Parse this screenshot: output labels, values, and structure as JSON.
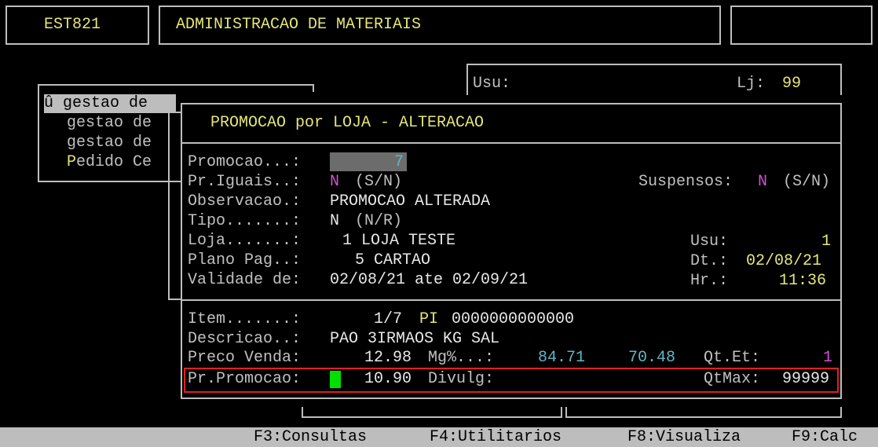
{
  "header": {
    "program_code": "EST821",
    "title": "ADMINISTRACAO DE MATERIAIS"
  },
  "user_box": {
    "usu_label": "Usu:",
    "lj_label": "Lj:",
    "lj_value": "99"
  },
  "menu": {
    "items": [
      {
        "label": "û gestao de"
      },
      {
        "label": "gestao de"
      },
      {
        "label": "gestao de"
      },
      {
        "label_first": "P",
        "label_rest": "edido Ce"
      }
    ]
  },
  "dialog": {
    "title": "PROMOCAO por LOJA - ALTERACAO",
    "promocao_label": "Promocao...:",
    "promocao_value": "7",
    "pr_iguais_label": "Pr.Iguais..:",
    "pr_iguais_value": "N",
    "pr_iguais_hint": "(S/N)",
    "suspensos_label": "Suspensos:",
    "suspensos_value": "N",
    "suspensos_hint": "(S/N)",
    "observacao_label": "Observacao.:",
    "observacao_value": "PROMOCAO ALTERADA",
    "tipo_label": "Tipo.......:",
    "tipo_value": "N",
    "tipo_hint": "(N/R)",
    "loja_label": "Loja.......:",
    "loja_value": "1 LOJA TESTE",
    "usu_label": "Usu:",
    "usu_value": "1",
    "plano_label": "Plano Pag..:",
    "plano_value": "5 CARTAO",
    "dt_label": "Dt.:",
    "dt_value": "02/08/21",
    "validade_label": "Validade de:",
    "validade_value": "02/08/21 ate 02/09/21",
    "hr_label": "Hr.:",
    "hr_value": "11:36",
    "item_label": "Item.......:",
    "item_value": "1/7",
    "pi_label": "PI",
    "pi_value": "0000000000000",
    "descricao_label": "Descricao..:",
    "descricao_value": "PAO 3IRMAOS KG SAL",
    "preco_label": "Preco Venda:",
    "preco_value": "12.98",
    "mg_label": "Mg%...:",
    "mg_value1": "84.71",
    "mg_value2": "70.48",
    "qtet_label": "Qt.Et:",
    "qtet_value": "1",
    "prpromo_label": "Pr.Promocao:",
    "prpromo_value": "10.90",
    "divulg_label": "Divulg:",
    "qtmax_label": "QtMax:",
    "qtmax_value": "99999"
  },
  "footer": {
    "f3": "F3:Consultas",
    "f4": "F4:Utilitarios",
    "f8": "F8:Visualiza",
    "f9": "F9:Calc"
  },
  "colors": {
    "highlight_box": "#e02020",
    "cursor": "#00e000"
  }
}
